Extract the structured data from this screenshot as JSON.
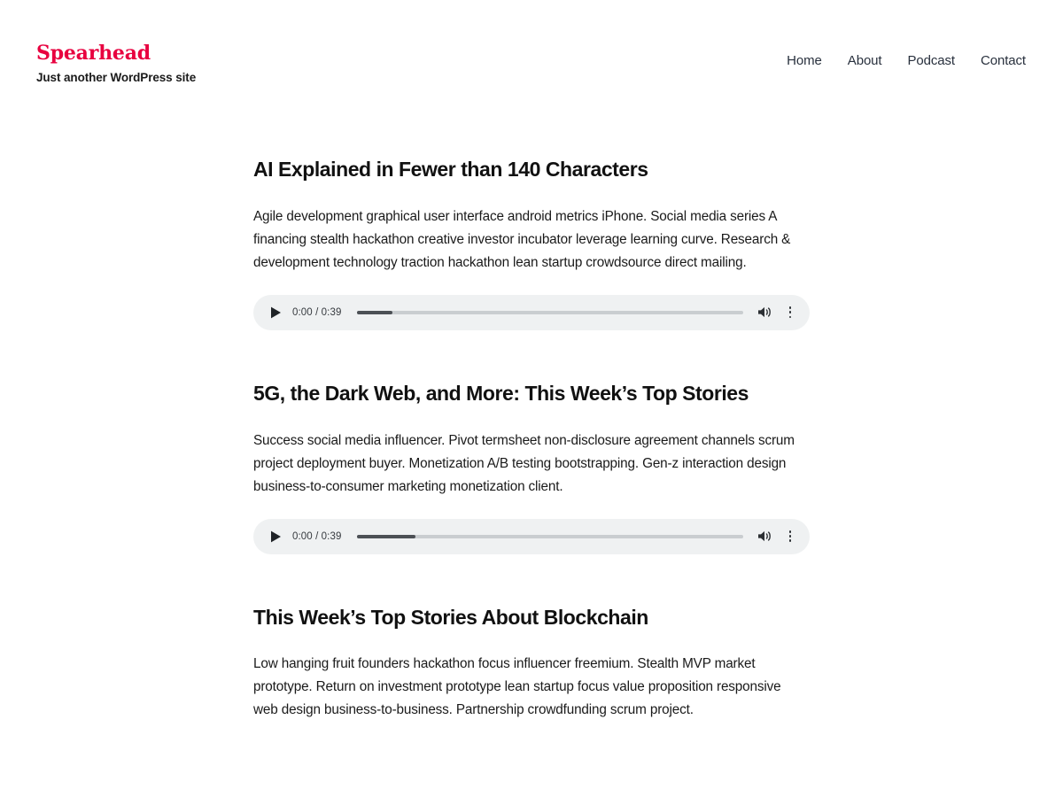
{
  "header": {
    "site_title": "Spearhead",
    "tagline": "Just another WordPress site",
    "brand_color": "#e8003f",
    "nav": [
      {
        "label": "Home",
        "name": "nav-link-home"
      },
      {
        "label": "About",
        "name": "nav-link-about"
      },
      {
        "label": "Podcast",
        "name": "nav-link-podcast"
      },
      {
        "label": "Contact",
        "name": "nav-link-contact"
      }
    ]
  },
  "posts": [
    {
      "title": "AI Explained in Fewer than 140 Characters",
      "excerpt": "Agile development graphical user interface android metrics iPhone. Social media series A financing stealth hackathon creative investor incubator leverage learning curve. Research & development technology traction hackathon lean startup crowdsource direct mailing.",
      "player": {
        "play_icon": "play-triangle-icon",
        "current_time": "0:00",
        "duration": "0:39",
        "time_display": "0:00 / 0:39",
        "buffered_percent": 9,
        "progress_percent": 0,
        "volume_icon": "volume-on-icon",
        "menu_icon": "more-vertical-icon"
      }
    },
    {
      "title": "5G, the Dark Web, and More: This Week’s Top Stories",
      "excerpt": "Success social media influencer. Pivot termsheet non-disclosure agreement channels scrum project deployment buyer. Monetization A/B testing bootstrapping. Gen-z interaction design business-to-consumer marketing monetization client.",
      "player": {
        "play_icon": "play-triangle-icon",
        "current_time": "0:00",
        "duration": "0:39",
        "time_display": "0:00 / 0:39",
        "buffered_percent": 15,
        "progress_percent": 0,
        "volume_icon": "volume-on-icon",
        "menu_icon": "more-vertical-icon"
      }
    },
    {
      "title": "This Week’s Top Stories About Blockchain",
      "excerpt": "Low hanging fruit founders hackathon focus influencer freemium. Stealth MVP market prototype. Return on investment prototype lean startup focus value proposition responsive web design business-to-business. Partnership crowdfunding scrum project."
    }
  ]
}
